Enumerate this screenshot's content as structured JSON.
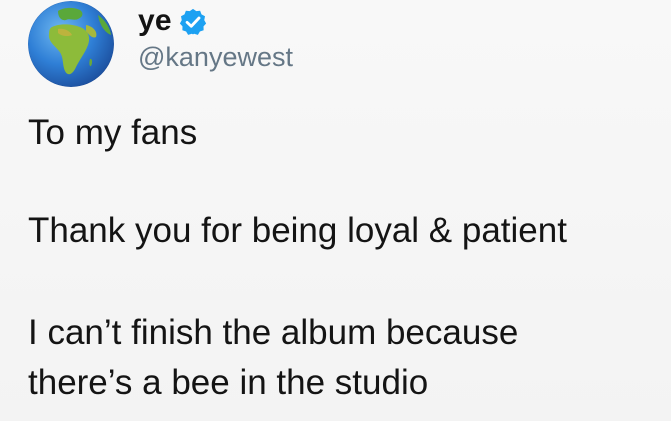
{
  "tweet": {
    "author": {
      "display_name": "ye",
      "handle": "@kanyewest",
      "verified": true,
      "avatar_icon": "globe-africa-emoji"
    },
    "text": {
      "line1": "To my fans",
      "line2": "Thank you for being loyal & patient",
      "line3": "I can’t finish the album because",
      "line4": "there’s a bee in the studio"
    }
  },
  "colors": {
    "background": "#f6f6f6",
    "text": "#141414",
    "handle": "#657786",
    "verified_badge": "#1da1f2"
  }
}
